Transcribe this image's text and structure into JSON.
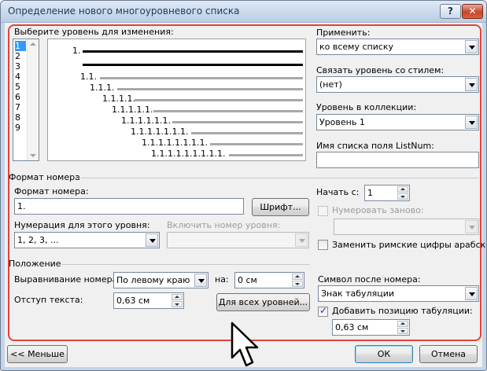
{
  "window": {
    "title": "Определение нового многоуровневого списка",
    "help_label": "?",
    "close_label": "✕"
  },
  "level_select": {
    "label": "Выберите уровень для изменения:",
    "levels": [
      "1",
      "2",
      "3",
      "4",
      "5",
      "6",
      "7",
      "8",
      "9"
    ],
    "selected": "1"
  },
  "preview": {
    "labels": [
      "1.",
      "1.1.",
      "1.1.1.",
      "1.1.1.1.",
      "1.1.1.1.1.",
      "1.1.1.1.1.1.",
      "1.1.1.1.1.1.1.",
      "1.1.1.1.1.1.1.1.",
      "1.1.1.1.1.1.1.1.1."
    ]
  },
  "apply": {
    "label": "Применить:",
    "value": "ко всему списку"
  },
  "link_style": {
    "label": "Связать уровень со стилем:",
    "value": "(нет)"
  },
  "gallery_level": {
    "label": "Уровень в коллекции:",
    "value": "Уровень 1"
  },
  "listnum": {
    "label": "Имя списка поля ListNum:",
    "value": ""
  },
  "number_format": {
    "section": "Формат номера",
    "format_label": "Формат номера:",
    "format_value": "1.",
    "font_button": "Шрифт...",
    "style_label": "Нумерация для этого уровня:",
    "style_value": "1, 2, 3, ...",
    "include_label": "Включить номер уровня:",
    "include_value": "",
    "start_label": "Начать с:",
    "start_value": "1",
    "restart_label": "Нумеровать заново:",
    "restart_value": "",
    "legal_label": "Заменить римские цифры арабскими"
  },
  "position": {
    "section": "Положение",
    "align_label": "Выравнивание номера:",
    "align_value": "По левому краю",
    "at_label": "на:",
    "at_value": "0 см",
    "indent_label": "Отступ текста:",
    "indent_value": "0,63 см",
    "all_levels_button": "Для всех уровней...",
    "follow_label": "Символ после номера:",
    "follow_value": "Знак табуляции",
    "tab_add_label": "Добавить позицию табуляции:",
    "tab_add_checked": true,
    "tab_value": "0,63 см"
  },
  "footer": {
    "less_button": "<< Меньше",
    "ok_button": "ОК",
    "cancel_button": "Отмена"
  },
  "colors": {
    "highlight_frame": "#e0433a",
    "selection": "#3399ff",
    "close_button": "#c8462d"
  }
}
